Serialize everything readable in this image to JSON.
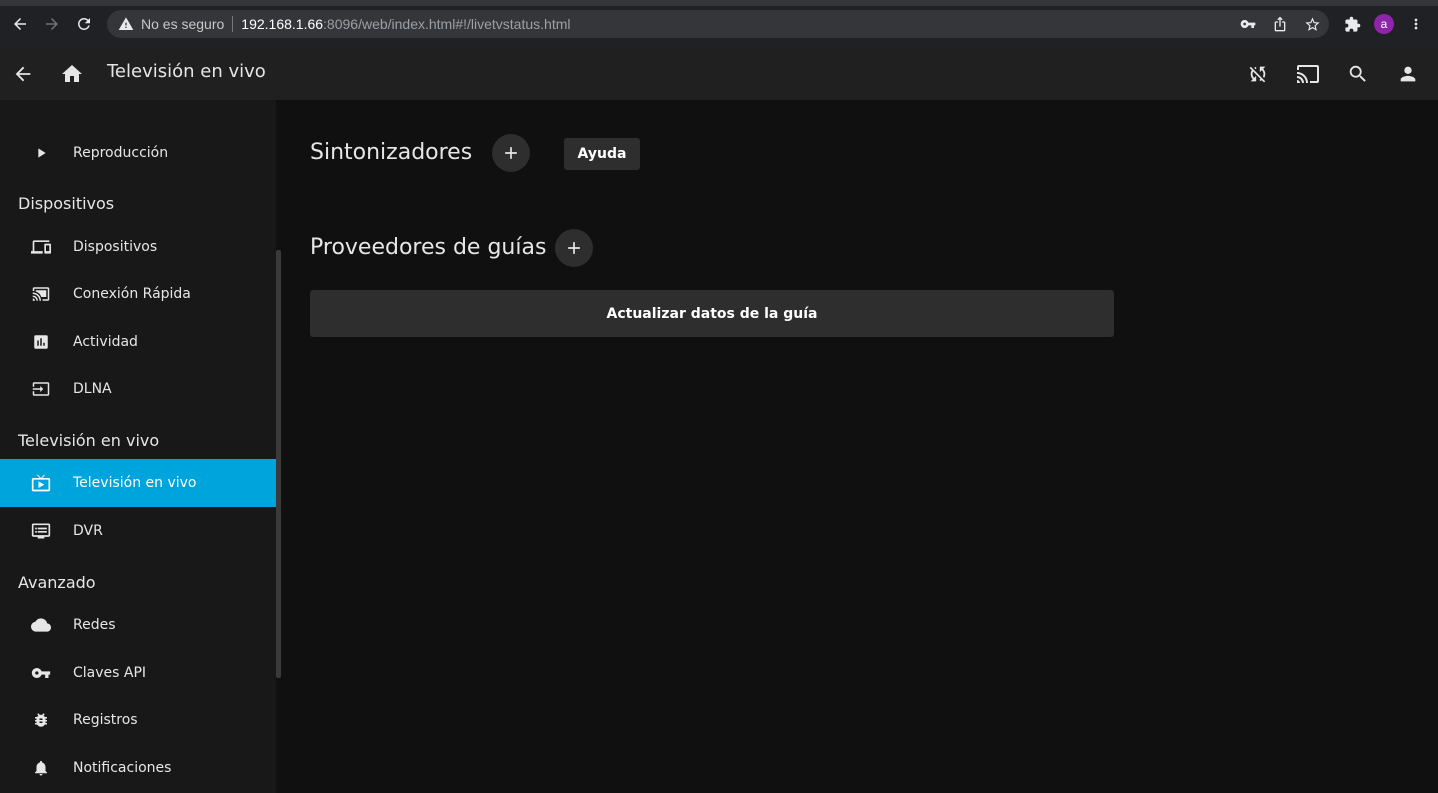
{
  "browser": {
    "insecure_label": "No es seguro",
    "url_host": "192.168.1.66",
    "url_rest": ":8096/web/index.html#!/livetvstatus.html",
    "profile_initial": "a",
    "profile_color": "#8e24aa"
  },
  "header": {
    "title": "Televisión en vivo"
  },
  "sidebar": {
    "accent": "#00a4dc",
    "items_top": [
      {
        "label": "Reproducción",
        "icon": "play-icon"
      }
    ],
    "section_devices": "Dispositivos",
    "items_devices": [
      {
        "label": "Dispositivos",
        "icon": "devices-icon"
      },
      {
        "label": "Conexión Rápida",
        "icon": "cast-connected-icon"
      },
      {
        "label": "Actividad",
        "icon": "chart-icon"
      },
      {
        "label": "DLNA",
        "icon": "input-icon"
      }
    ],
    "section_livetv": "Televisión en vivo",
    "items_livetv": [
      {
        "label": "Televisión en vivo",
        "icon": "live-tv-icon",
        "active": true
      },
      {
        "label": "DVR",
        "icon": "dvr-icon"
      }
    ],
    "section_advanced": "Avanzado",
    "items_advanced": [
      {
        "label": "Redes",
        "icon": "cloud-icon"
      },
      {
        "label": "Claves API",
        "icon": "key-icon"
      },
      {
        "label": "Registros",
        "icon": "bug-icon"
      },
      {
        "label": "Notificaciones",
        "icon": "bell-icon"
      }
    ]
  },
  "main": {
    "tuners_title": "Sintonizadores",
    "help_label": "Ayuda",
    "guide_providers_title": "Proveedores de guías",
    "refresh_guide_label": "Actualizar datos de la guía",
    "add_symbol": "+"
  }
}
